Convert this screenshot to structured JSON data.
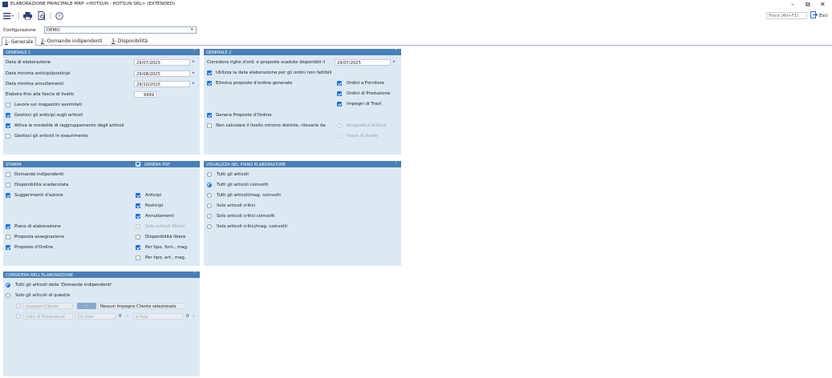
{
  "window": {
    "title": "ELABORAZIONE PRINCIPALE MRP <HOTSUN - HOTSUN SRL> (EXTENDED)",
    "minimize": "–",
    "restore": "⧉",
    "close": "✕"
  },
  "toolbar": {
    "find_label": "Trova (Alt+F1)",
    "exit_label": "Esci"
  },
  "config": {
    "label": "Configurazione",
    "value": "DEMO"
  },
  "tabs": [
    {
      "key": "1",
      "label": "- Generale"
    },
    {
      "key": "2",
      "label": "- Domande indipendenti"
    },
    {
      "key": "3",
      "label": "- Disponibilità"
    }
  ],
  "generale1": {
    "header": "GENERALE 1",
    "data_elaborazione": {
      "label": "Data di elaborazione",
      "value": "29/07/2025"
    },
    "data_anticipi": {
      "label": "Data minima anticipi/posticipi",
      "value": "29/08/2025"
    },
    "data_annullamenti": {
      "label": "Data minima annullamenti",
      "value": "29/10/2025"
    },
    "fascia": {
      "label": "Elabora fino alla fascia di livello",
      "value": "9999"
    },
    "checks": [
      {
        "label": "Lavora sui magazzini assimilati",
        "checked": false
      },
      {
        "label": "Gestisci gli anticipi sugli articoli",
        "checked": true
      },
      {
        "label": "Attiva le modalità di raggruppamento degli articoli",
        "checked": true
      },
      {
        "label": "Gestisci gli articoli in esaurimento",
        "checked": false
      }
    ]
  },
  "generale2": {
    "header": "GENERALE 2",
    "considera": {
      "label": "Considera righe d'ord. e proposte scadute disponibili il",
      "value": "29/07/2025"
    },
    "utilizza": "Utilizza la data elaborazione per gli ordini non fattibili",
    "elimina": "Elimina proposte d'ordine generate",
    "ordini_fornitore": "Ordini a Fornitore",
    "ordini_produzione": "Ordini di Produzione",
    "impegni_trasf": "Impegni di Trasf.",
    "genera_proposte": "Genera Proposte d'Ordine",
    "non_calcolare": "Non calcolare il livello minimo distinte, rilevarlo da",
    "anagrafica": "Anagrafica Articoli",
    "fasce": "Fasce di livello"
  },
  "stampa": {
    "header": "STAMPA",
    "genera_pdf": "GENERA PDF",
    "left": [
      {
        "label": "Domande indipendenti",
        "checked": false
      },
      {
        "label": "Disponibilità scadenziata",
        "checked": false
      },
      {
        "label": "Suggerimenti d'azione",
        "checked": true
      },
      {
        "label": "Piano di elaborazione",
        "checked": true
      },
      {
        "label": "Proposta assegnazione",
        "checked": false
      },
      {
        "label": "Proposte d'Ordine",
        "checked": true
      }
    ],
    "right": [
      {
        "label": "Anticipi",
        "checked": true,
        "disabled": false
      },
      {
        "label": "Posticipi",
        "checked": true,
        "disabled": false
      },
      {
        "label": "Annullamenti",
        "checked": true,
        "disabled": false
      },
      {
        "label": "Solo articoli filtrati",
        "checked": false,
        "disabled": true
      },
      {
        "label": "Disponibilità libere",
        "checked": false,
        "disabled": false
      },
      {
        "label": "Per tipo, forn., mag.",
        "checked": true,
        "disabled": false
      },
      {
        "label": "Per tipo, art., mag.",
        "checked": false,
        "disabled": false
      }
    ]
  },
  "visualizza": {
    "header": "VISUALIZZA NEL PIANO ELABORAZIONE",
    "options": [
      {
        "label": "Tutti gli articoli",
        "selected": false
      },
      {
        "label": "Tutti gli articoli coinvolti",
        "selected": true
      },
      {
        "label": "Tutti gli articoli/mag. coinvolti",
        "selected": false
      },
      {
        "label": "Solo articoli critici",
        "selected": false
      },
      {
        "label": "Solo articoli critici coinvolti",
        "selected": false
      },
      {
        "label": "Solo articoli critici/mag. coinvolti",
        "selected": false
      }
    ]
  },
  "considera": {
    "header": "CONSIDERA NELL'ELABORAZIONE",
    "opt_tutti": "Tutti gli articoli delle 'Domande indipendenti'",
    "opt_solo": "Solo gli articoli di quest/e",
    "impegni_cliente": "Impegni Cliente",
    "btn_dots": "...",
    "nessun_impegno": "Nessun Impegno Cliente selezionato",
    "liste_produzione": "Liste di Produzione",
    "da_lista": "Da lista",
    "da_value": "0",
    "a_lista": "a lista",
    "a_value": "0"
  }
}
